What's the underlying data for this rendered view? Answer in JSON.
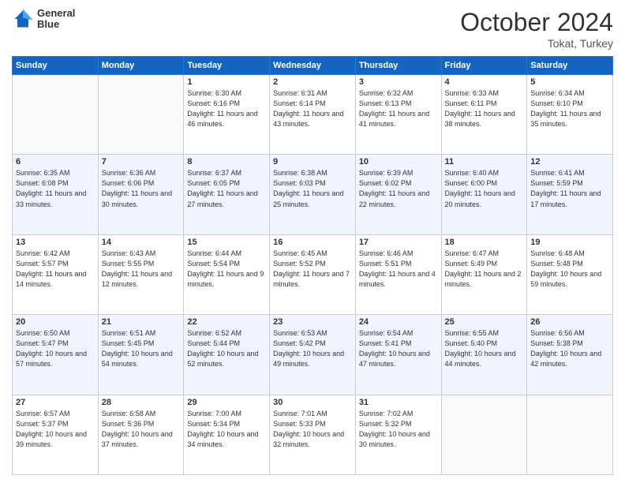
{
  "header": {
    "logo_line1": "General",
    "logo_line2": "Blue",
    "month": "October 2024",
    "location": "Tokat, Turkey"
  },
  "days_of_week": [
    "Sunday",
    "Monday",
    "Tuesday",
    "Wednesday",
    "Thursday",
    "Friday",
    "Saturday"
  ],
  "weeks": [
    [
      {
        "day": "",
        "info": ""
      },
      {
        "day": "",
        "info": ""
      },
      {
        "day": "1",
        "info": "Sunrise: 6:30 AM\nSunset: 6:16 PM\nDaylight: 11 hours and 46 minutes."
      },
      {
        "day": "2",
        "info": "Sunrise: 6:31 AM\nSunset: 6:14 PM\nDaylight: 11 hours and 43 minutes."
      },
      {
        "day": "3",
        "info": "Sunrise: 6:32 AM\nSunset: 6:13 PM\nDaylight: 11 hours and 41 minutes."
      },
      {
        "day": "4",
        "info": "Sunrise: 6:33 AM\nSunset: 6:11 PM\nDaylight: 11 hours and 38 minutes."
      },
      {
        "day": "5",
        "info": "Sunrise: 6:34 AM\nSunset: 6:10 PM\nDaylight: 11 hours and 35 minutes."
      }
    ],
    [
      {
        "day": "6",
        "info": "Sunrise: 6:35 AM\nSunset: 6:08 PM\nDaylight: 11 hours and 33 minutes."
      },
      {
        "day": "7",
        "info": "Sunrise: 6:36 AM\nSunset: 6:06 PM\nDaylight: 11 hours and 30 minutes."
      },
      {
        "day": "8",
        "info": "Sunrise: 6:37 AM\nSunset: 6:05 PM\nDaylight: 11 hours and 27 minutes."
      },
      {
        "day": "9",
        "info": "Sunrise: 6:38 AM\nSunset: 6:03 PM\nDaylight: 11 hours and 25 minutes."
      },
      {
        "day": "10",
        "info": "Sunrise: 6:39 AM\nSunset: 6:02 PM\nDaylight: 11 hours and 22 minutes."
      },
      {
        "day": "11",
        "info": "Sunrise: 6:40 AM\nSunset: 6:00 PM\nDaylight: 11 hours and 20 minutes."
      },
      {
        "day": "12",
        "info": "Sunrise: 6:41 AM\nSunset: 5:59 PM\nDaylight: 11 hours and 17 minutes."
      }
    ],
    [
      {
        "day": "13",
        "info": "Sunrise: 6:42 AM\nSunset: 5:57 PM\nDaylight: 11 hours and 14 minutes."
      },
      {
        "day": "14",
        "info": "Sunrise: 6:43 AM\nSunset: 5:55 PM\nDaylight: 11 hours and 12 minutes."
      },
      {
        "day": "15",
        "info": "Sunrise: 6:44 AM\nSunset: 5:54 PM\nDaylight: 11 hours and 9 minutes."
      },
      {
        "day": "16",
        "info": "Sunrise: 6:45 AM\nSunset: 5:52 PM\nDaylight: 11 hours and 7 minutes."
      },
      {
        "day": "17",
        "info": "Sunrise: 6:46 AM\nSunset: 5:51 PM\nDaylight: 11 hours and 4 minutes."
      },
      {
        "day": "18",
        "info": "Sunrise: 6:47 AM\nSunset: 5:49 PM\nDaylight: 11 hours and 2 minutes."
      },
      {
        "day": "19",
        "info": "Sunrise: 6:48 AM\nSunset: 5:48 PM\nDaylight: 10 hours and 59 minutes."
      }
    ],
    [
      {
        "day": "20",
        "info": "Sunrise: 6:50 AM\nSunset: 5:47 PM\nDaylight: 10 hours and 57 minutes."
      },
      {
        "day": "21",
        "info": "Sunrise: 6:51 AM\nSunset: 5:45 PM\nDaylight: 10 hours and 54 minutes."
      },
      {
        "day": "22",
        "info": "Sunrise: 6:52 AM\nSunset: 5:44 PM\nDaylight: 10 hours and 52 minutes."
      },
      {
        "day": "23",
        "info": "Sunrise: 6:53 AM\nSunset: 5:42 PM\nDaylight: 10 hours and 49 minutes."
      },
      {
        "day": "24",
        "info": "Sunrise: 6:54 AM\nSunset: 5:41 PM\nDaylight: 10 hours and 47 minutes."
      },
      {
        "day": "25",
        "info": "Sunrise: 6:55 AM\nSunset: 5:40 PM\nDaylight: 10 hours and 44 minutes."
      },
      {
        "day": "26",
        "info": "Sunrise: 6:56 AM\nSunset: 5:38 PM\nDaylight: 10 hours and 42 minutes."
      }
    ],
    [
      {
        "day": "27",
        "info": "Sunrise: 6:57 AM\nSunset: 5:37 PM\nDaylight: 10 hours and 39 minutes."
      },
      {
        "day": "28",
        "info": "Sunrise: 6:58 AM\nSunset: 5:36 PM\nDaylight: 10 hours and 37 minutes."
      },
      {
        "day": "29",
        "info": "Sunrise: 7:00 AM\nSunset: 5:34 PM\nDaylight: 10 hours and 34 minutes."
      },
      {
        "day": "30",
        "info": "Sunrise: 7:01 AM\nSunset: 5:33 PM\nDaylight: 10 hours and 32 minutes."
      },
      {
        "day": "31",
        "info": "Sunrise: 7:02 AM\nSunset: 5:32 PM\nDaylight: 10 hours and 30 minutes."
      },
      {
        "day": "",
        "info": ""
      },
      {
        "day": "",
        "info": ""
      }
    ]
  ]
}
